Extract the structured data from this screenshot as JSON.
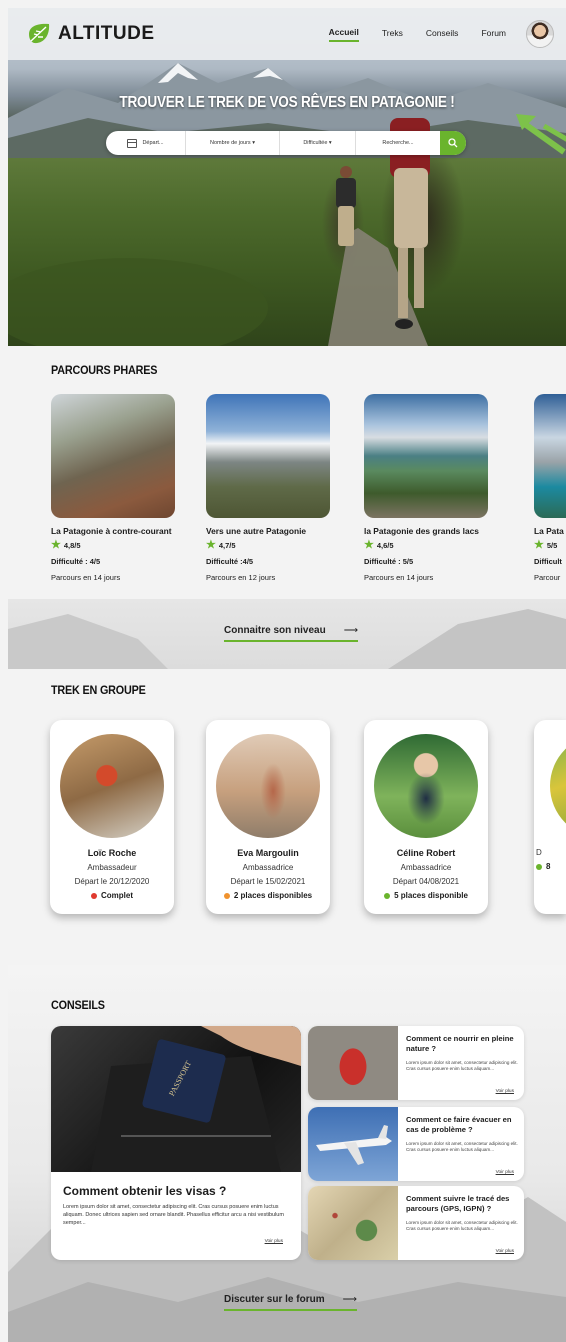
{
  "header": {
    "brand": "ALTITUDE",
    "nav": [
      "Accueil",
      "Treks",
      "Conseils",
      "Forum"
    ],
    "active_nav": "Accueil"
  },
  "hero": {
    "title": "TROUVER LE TREK DE VOS RÊVES EN PATAGONIE !",
    "search": {
      "depart": "Départ...",
      "jours": "Nombre de jours ▾",
      "difficulte": "Difficultée ▾",
      "recherche": "Recherche..."
    }
  },
  "parcours": {
    "title": "PARCOURS PHARES",
    "items": [
      {
        "name": "La Patagonie à contre-courant",
        "rating": "4,8/5",
        "difficulty": "Difficulté : 4/5",
        "days": "Parcours en 14 jours"
      },
      {
        "name": "Vers une autre Patagonie",
        "rating": "4,7/5",
        "difficulty": "Difficulté :4/5",
        "days": "Parcours en 12 jours"
      },
      {
        "name": "la Patagonie des grands lacs",
        "rating": "4,6/5",
        "difficulty": "Difficulté : 5/5",
        "days": "Parcours en 14 jours"
      },
      {
        "name": "La Pata",
        "rating": "5/5",
        "difficulty": "Difficult",
        "days": "Parcour"
      }
    ],
    "link": "Connaitre son niveau"
  },
  "groupe": {
    "title": "TREK EN GROUPE",
    "items": [
      {
        "name": "Loïc Roche",
        "role": "Ambassadeur",
        "date": "Départ le 20/12/2020",
        "status": "Complet",
        "status_color": "#e03a2f"
      },
      {
        "name": "Eva Margoulin",
        "role": "Ambassadrice",
        "date": "Départ le 15/02/2021",
        "status": "2 places disponibles",
        "status_color": "#f0922e"
      },
      {
        "name": "Céline Robert",
        "role": "Ambassadrice",
        "date": "Départ 04/08/2021",
        "status": "5 places disponible",
        "status_color": "#6ab42d"
      },
      {
        "name": "",
        "role": "",
        "date": "D",
        "status": "8",
        "status_color": "#6ab42d"
      }
    ]
  },
  "conseils": {
    "title": "CONSEILS",
    "main": {
      "title": "Comment obtenir les visas ?",
      "text": "Lorem ipsum dolor sit amet, consectetur adipiscing elit. Cras cursus posuere enim luctus aliquam. Donec ultrices sapien sed ornare blandit. Phasellus efficitur arcu a nisi vestibulum semper...",
      "more": "Voir plus"
    },
    "items": [
      {
        "title": "Comment ce nourrir en pleine nature ?",
        "text": "Lorem ipsum dolor sit amet, consectetur adipiscing elit. Cras cursus posuere enim luctus aliquam...",
        "more": "Voir plus"
      },
      {
        "title": "Comment ce faire évacuer en cas de problème ?",
        "text": "Lorem ipsum dolor sit amet, consectetur adipiscing elit. Cras cursus posuere enim luctus aliquam...",
        "more": "Voir plus"
      },
      {
        "title": "Comment suivre le tracé des parcours (GPS, IGPN) ?",
        "text": "Lorem ipsum dolor sit amet, consectetur adipiscing elit. Cras cursus posuere enim luctus aliquam...",
        "more": "Voir plus"
      }
    ],
    "link": "Discuter sur le forum"
  },
  "colors": {
    "accent": "#6ab42d"
  }
}
